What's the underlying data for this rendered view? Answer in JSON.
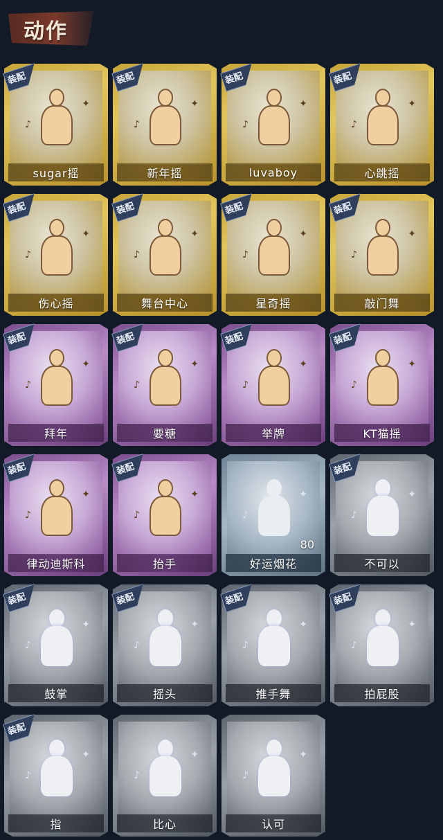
{
  "header": {
    "title": "动作"
  },
  "equip_label": "装配",
  "cards": [
    {
      "name": "sugar摇",
      "tier": "gold",
      "equipped": true,
      "icon": "dance-pose-icon"
    },
    {
      "name": "新年摇",
      "tier": "gold",
      "equipped": true,
      "icon": "dance-pose-icon"
    },
    {
      "name": "luvaboy",
      "tier": "gold",
      "equipped": true,
      "icon": "dance-pose-icon"
    },
    {
      "name": "心跳摇",
      "tier": "gold",
      "equipped": true,
      "icon": "dance-pose-icon"
    },
    {
      "name": "伤心摇",
      "tier": "gold",
      "equipped": true,
      "icon": "heart-hands-pose-icon"
    },
    {
      "name": "舞台中心",
      "tier": "gold",
      "equipped": true,
      "icon": "dance-pose-icon"
    },
    {
      "name": "星奇摇",
      "tier": "gold",
      "equipped": true,
      "icon": "dance-pose-icon"
    },
    {
      "name": "敲门舞",
      "tier": "gold",
      "equipped": true,
      "icon": "dance-pose-icon"
    },
    {
      "name": "拜年",
      "tier": "purple",
      "equipped": true,
      "icon": "bow-pose-icon"
    },
    {
      "name": "要糖",
      "tier": "purple",
      "equipped": true,
      "icon": "reach-pose-icon"
    },
    {
      "name": "举牌",
      "tier": "purple",
      "equipped": true,
      "icon": "sign-pose-icon"
    },
    {
      "name": "KT猫摇",
      "tier": "purple",
      "equipped": true,
      "icon": "dance-pose-icon"
    },
    {
      "name": "律动迪斯科",
      "tier": "purple",
      "equipped": true,
      "icon": "disco-pose-icon"
    },
    {
      "name": "抬手",
      "tier": "purple",
      "equipped": true,
      "icon": "raise-hand-pose-icon"
    },
    {
      "name": "好运烟花",
      "tier": "blue",
      "equipped": false,
      "icon": "firework-icon",
      "count": "80"
    },
    {
      "name": "不可以",
      "tier": "gray",
      "equipped": true,
      "icon": "finger-wag-icon"
    },
    {
      "name": "鼓掌",
      "tier": "gray",
      "equipped": true,
      "icon": "clap-hands-icon"
    },
    {
      "name": "摇头",
      "tier": "gray",
      "equipped": true,
      "icon": "shake-head-pose-icon"
    },
    {
      "name": "推手舞",
      "tier": "gray",
      "equipped": true,
      "icon": "push-dance-pose-icon"
    },
    {
      "name": "拍屁股",
      "tier": "gray",
      "equipped": true,
      "icon": "slap-pose-icon"
    },
    {
      "name": "指",
      "tier": "gray",
      "equipped": true,
      "icon": "point-hand-icon"
    },
    {
      "name": "比心",
      "tier": "gray",
      "equipped": false,
      "icon": "finger-heart-icon"
    },
    {
      "name": "认可",
      "tier": "gray",
      "equipped": false,
      "icon": "thumbs-up-icon"
    }
  ]
}
